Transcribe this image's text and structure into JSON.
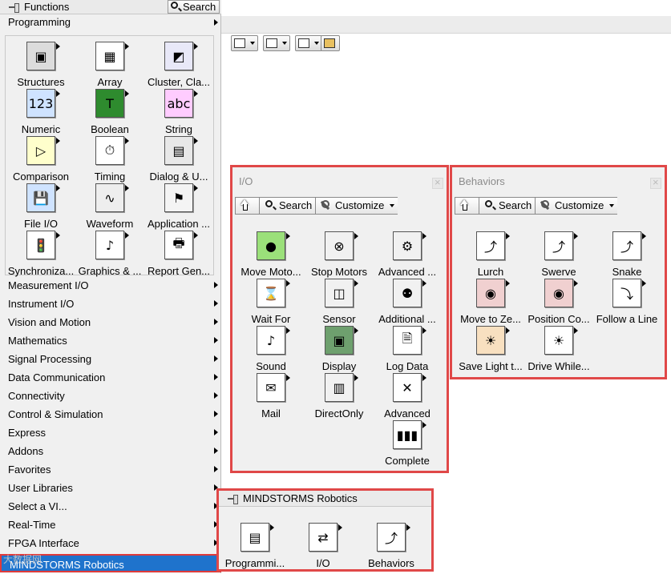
{
  "functions": {
    "title": "Functions",
    "search_label": "Search",
    "category": "Programming",
    "programming_items": [
      {
        "label": "Structures",
        "icon": "structures-icon",
        "glyph": "▣",
        "color": "#dcdcdc"
      },
      {
        "label": "Array",
        "icon": "array-icon",
        "glyph": "▦",
        "color": "#ffffff"
      },
      {
        "label": "Cluster, Cla...",
        "icon": "cluster-icon",
        "glyph": "◩",
        "color": "#e8e8f8"
      },
      {
        "label": "Numeric",
        "icon": "numeric-icon",
        "glyph": "123",
        "color": "#cfe3ff"
      },
      {
        "label": "Boolean",
        "icon": "boolean-icon",
        "glyph": "T",
        "color": "#2e8b2e"
      },
      {
        "label": "String",
        "icon": "string-icon",
        "glyph": "abc",
        "color": "#ffccff"
      },
      {
        "label": "Comparison",
        "icon": "comparison-icon",
        "glyph": "▷",
        "color": "#ffffcc"
      },
      {
        "label": "Timing",
        "icon": "timing-icon",
        "glyph": "⏱",
        "color": "#ffffff"
      },
      {
        "label": "Dialog & U...",
        "icon": "dialog-icon",
        "glyph": "▤",
        "color": "#e8e8e8"
      },
      {
        "label": "File I/O",
        "icon": "file-io-icon",
        "glyph": "💾",
        "color": "#cfe3ff"
      },
      {
        "label": "Waveform",
        "icon": "waveform-icon",
        "glyph": "∿",
        "color": "#eeeeee"
      },
      {
        "label": "Application ...",
        "icon": "application-control-icon",
        "glyph": "⚑",
        "color": "#f4f4f4"
      },
      {
        "label": "Synchroniza...",
        "icon": "synchronization-icon",
        "glyph": "🚦",
        "color": "#ffffff"
      },
      {
        "label": "Graphics & ...",
        "icon": "graphics-sound-icon",
        "glyph": "♪",
        "color": "#ffffff"
      },
      {
        "label": "Report Gen...",
        "icon": "report-generation-icon",
        "glyph": "🖶",
        "color": "#ffffff"
      }
    ],
    "categories": [
      {
        "label": "Measurement I/O"
      },
      {
        "label": "Instrument I/O"
      },
      {
        "label": "Vision and Motion"
      },
      {
        "label": "Mathematics"
      },
      {
        "label": "Signal Processing"
      },
      {
        "label": "Data Communication"
      },
      {
        "label": "Connectivity"
      },
      {
        "label": "Control & Simulation"
      },
      {
        "label": "Express"
      },
      {
        "label": "Addons"
      },
      {
        "label": "Favorites"
      },
      {
        "label": "User Libraries"
      },
      {
        "label": "Select a VI..."
      },
      {
        "label": "Real-Time"
      },
      {
        "label": "FPGA Interface"
      }
    ],
    "selected_category": "MINDSTORMS Robotics",
    "watermark": "大数据网"
  },
  "io_palette": {
    "title": "I/O",
    "search_label": "Search",
    "customize_label": "Customize",
    "items": [
      {
        "label": "Move Moto...",
        "icon": "move-motors-icon",
        "glyph": "●",
        "color": "#9be07a"
      },
      {
        "label": "Stop Motors",
        "icon": "stop-motors-icon",
        "glyph": "⊗",
        "color": "#f1f1f1"
      },
      {
        "label": "Advanced ...",
        "icon": "advanced-gear-icon",
        "glyph": "⚙",
        "color": "#f1f1f1"
      },
      {
        "label": "Wait For",
        "icon": "wait-for-icon",
        "glyph": "⌛",
        "color": "#ffffff"
      },
      {
        "label": "Sensor",
        "icon": "sensor-icon",
        "glyph": "◫",
        "color": "#f1f1f1"
      },
      {
        "label": "Additional ...",
        "icon": "additional-sensors-icon",
        "glyph": "⚉",
        "color": "#f1f1f1"
      },
      {
        "label": "Sound",
        "icon": "sound-icon",
        "glyph": "♪",
        "color": "#ffffff"
      },
      {
        "label": "Display",
        "icon": "display-icon",
        "glyph": "▣",
        "color": "#6ea06e"
      },
      {
        "label": "Log Data",
        "icon": "log-data-icon",
        "glyph": "🗎",
        "color": "#ffffff"
      },
      {
        "label": "Mail",
        "icon": "mail-icon",
        "glyph": "✉",
        "color": "#ffffff"
      },
      {
        "label": "DirectOnly",
        "icon": "direct-only-icon",
        "glyph": "▥",
        "color": "#f1f1f1"
      },
      {
        "label": "Advanced",
        "icon": "advanced-tools-icon",
        "glyph": "✕",
        "color": "#ffffff"
      },
      {
        "label": "Complete",
        "icon": "complete-books-icon",
        "glyph": "▮▮▮",
        "color": "#ffffff"
      }
    ]
  },
  "behaviors_palette": {
    "title": "Behaviors",
    "search_label": "Search",
    "customize_label": "Customize",
    "items": [
      {
        "label": "Lurch",
        "icon": "lurch-icon",
        "glyph": "⤴",
        "color": "#ffffff"
      },
      {
        "label": "Swerve",
        "icon": "swerve-icon",
        "glyph": "⤴",
        "color": "#ffffff"
      },
      {
        "label": "Snake",
        "icon": "snake-icon",
        "glyph": "⤴",
        "color": "#ffffff"
      },
      {
        "label": "Move to Ze...",
        "icon": "move-to-zero-icon",
        "glyph": "◉",
        "color": "#f0d0d0"
      },
      {
        "label": "Position Co...",
        "icon": "position-control-icon",
        "glyph": "◉",
        "color": "#f0d0d0"
      },
      {
        "label": "Follow a Line",
        "icon": "follow-line-icon",
        "glyph": "⤵",
        "color": "#ffffff"
      },
      {
        "label": "Save Light t...",
        "icon": "save-light-icon",
        "glyph": "☀",
        "color": "#f8e0c0"
      },
      {
        "label": "Drive While...",
        "icon": "drive-while-icon",
        "glyph": "☀",
        "color": "#ffffff"
      }
    ]
  },
  "mindstorms_palette": {
    "title": "MINDSTORMS Robotics",
    "items": [
      {
        "label": "Programmi...",
        "icon": "programming-icon",
        "glyph": "▤",
        "color": "#ffffff"
      },
      {
        "label": "I/O",
        "icon": "io-icon",
        "glyph": "⇄",
        "color": "#ffffff"
      },
      {
        "label": "Behaviors",
        "icon": "behaviors-icon",
        "glyph": "⤴",
        "color": "#ffffff"
      }
    ]
  }
}
